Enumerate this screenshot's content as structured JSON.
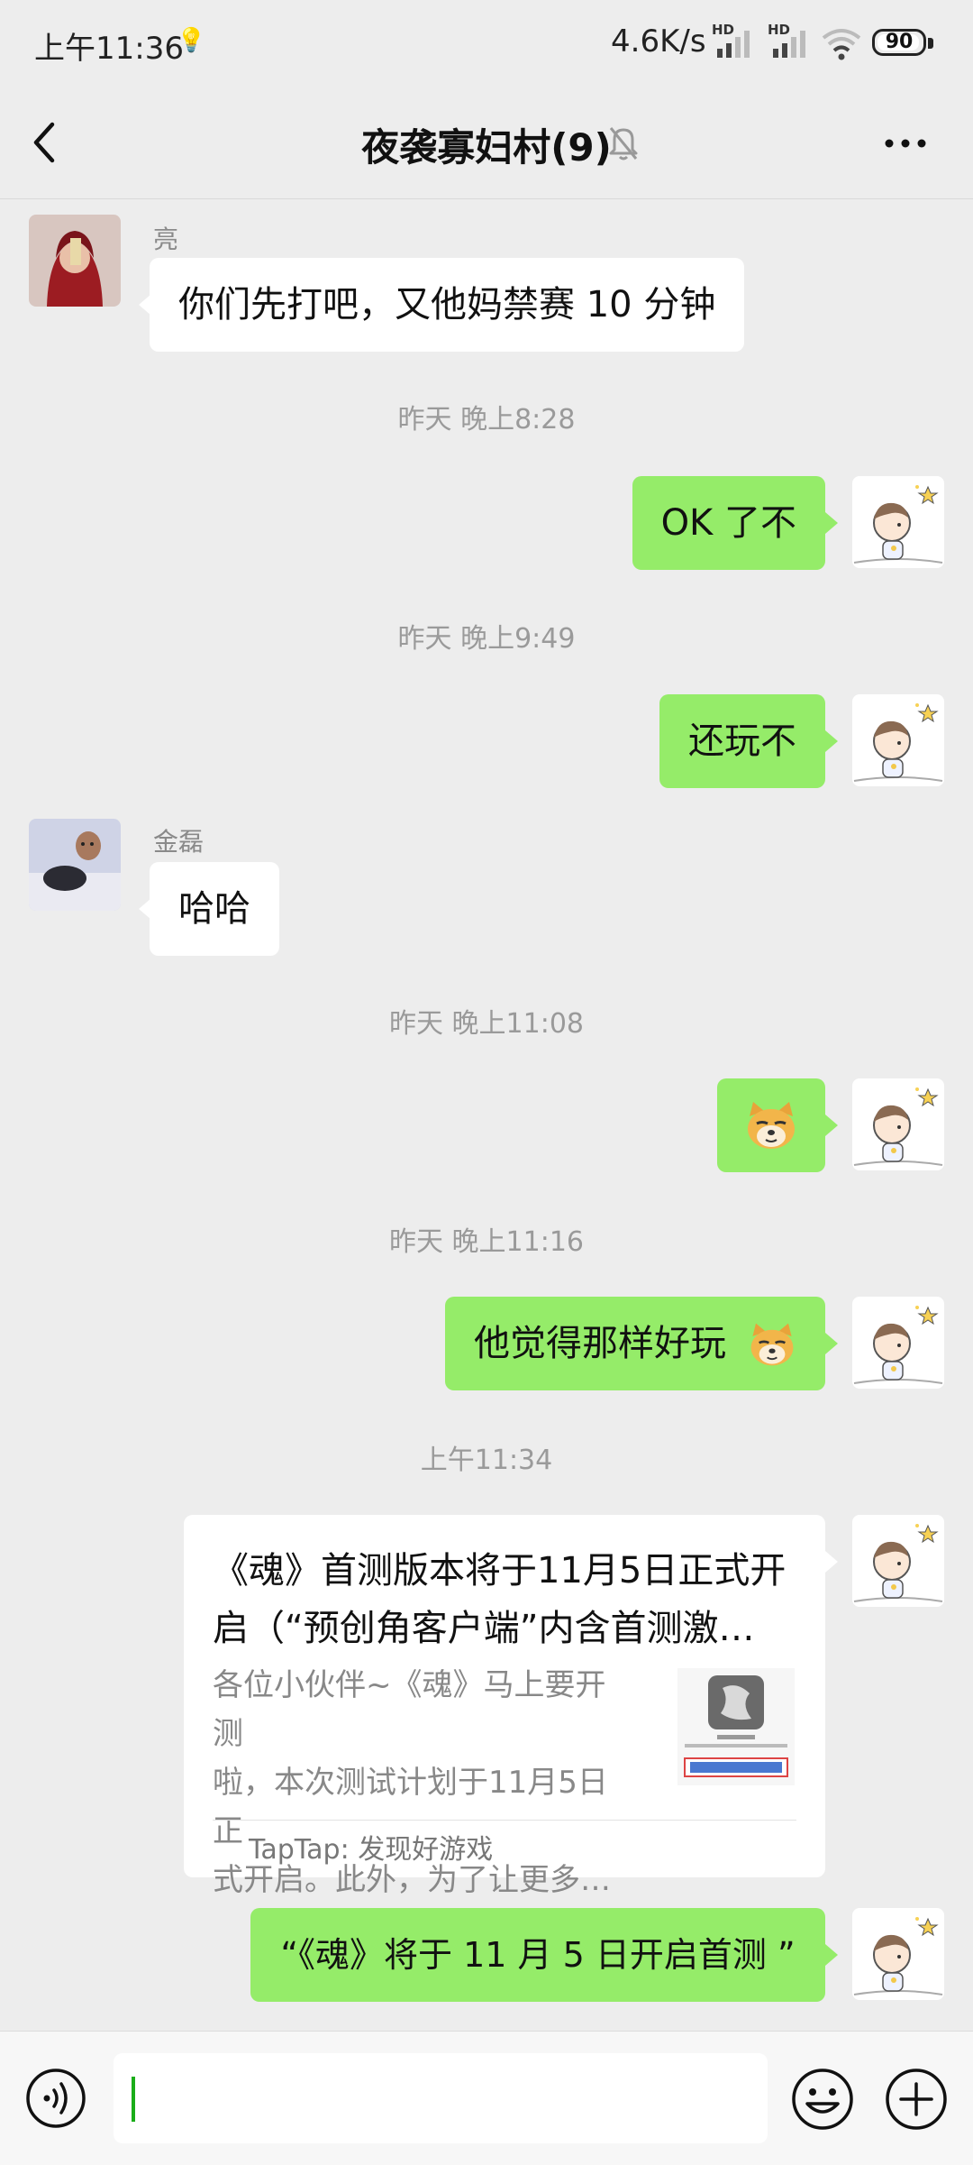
{
  "status_bar": {
    "time": "上午11:36",
    "network_speed": "4.6K/s",
    "battery": "90",
    "signal_badge": "HD"
  },
  "header": {
    "title": "夜袭寡妇村(9)",
    "muted": true
  },
  "messages": [
    {
      "sender": "亮",
      "text": "你们先打吧，又他妈禁赛 10 分钟"
    },
    {
      "timestamp": "昨天 晚上8:28"
    },
    {
      "text": "OK 了不"
    },
    {
      "timestamp": "昨天 晚上9:49"
    },
    {
      "text": "还玩不"
    },
    {
      "sender": "金磊",
      "text": "哈哈"
    },
    {
      "timestamp": "昨天 晚上11:08"
    },
    {
      "emoji": "doge-emoji"
    },
    {
      "timestamp": "昨天 晚上11:16"
    },
    {
      "text": "他觉得那样好玩"
    },
    {
      "timestamp": "上午11:34"
    },
    {
      "card": {
        "title_line1": "《魂》首测版本将于11月5日正式开",
        "title_line2": "启（“预创角客户端”内含首测激…",
        "desc_line1": "各位小伙伴~《魂》马上要开测",
        "desc_line2": "啦，本次测试计划于11月5日正",
        "desc_line3": "式开启。此外，为了让更多…",
        "source": "TapTap: 发现好游戏"
      }
    },
    {
      "text": "“《魂》将于 11 月 5 日开启首测 ”"
    }
  ],
  "colors": {
    "background": "#ededed",
    "outgoing_bubble": "#95ec69",
    "incoming_bubble": "#ffffff",
    "cursor": "#1aad19"
  },
  "icons": {
    "back": "chevron-left-icon",
    "mute": "bell-off-icon",
    "more": "more-dots-icon",
    "voice": "voice-icon",
    "emoji": "smiley-icon",
    "plus": "plus-icon"
  }
}
